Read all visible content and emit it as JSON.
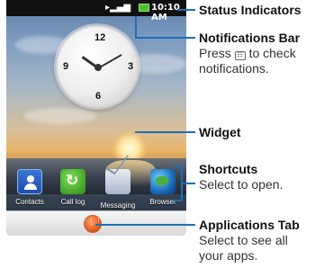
{
  "status_bar": {
    "time": "10:10 AM",
    "icons": [
      "speaker-icon",
      "signal-bars-icon",
      "battery-icon"
    ]
  },
  "widget": {
    "clock_numbers": [
      "12",
      "3",
      "6",
      "9"
    ]
  },
  "shortcuts": [
    {
      "label": "Contacts",
      "icon": "contacts-icon"
    },
    {
      "label": "Call log",
      "icon": "call-log-icon"
    },
    {
      "label": "Messaging",
      "icon": "messaging-icon"
    },
    {
      "label": "Browser",
      "icon": "browser-icon"
    }
  ],
  "applications_tab": {
    "icon": "app-grid-icon"
  },
  "callouts": {
    "status_indicators": {
      "title": "Status Indicators"
    },
    "notifications_bar": {
      "title": "Notifications Bar",
      "desc_before": "Press",
      "desc_after": "to check notifications.",
      "key_icon": "menu-key-icon"
    },
    "widget": {
      "title": "Widget"
    },
    "shortcuts": {
      "title": "Shortcuts",
      "desc": "Select to open."
    },
    "applications_tab": {
      "title": "Applications Tab",
      "desc": "Select to see all your apps."
    }
  },
  "colors": {
    "callout_line": "#1d6fb6",
    "apps_tab": "#e2561c",
    "battery": "#4cc22b"
  }
}
